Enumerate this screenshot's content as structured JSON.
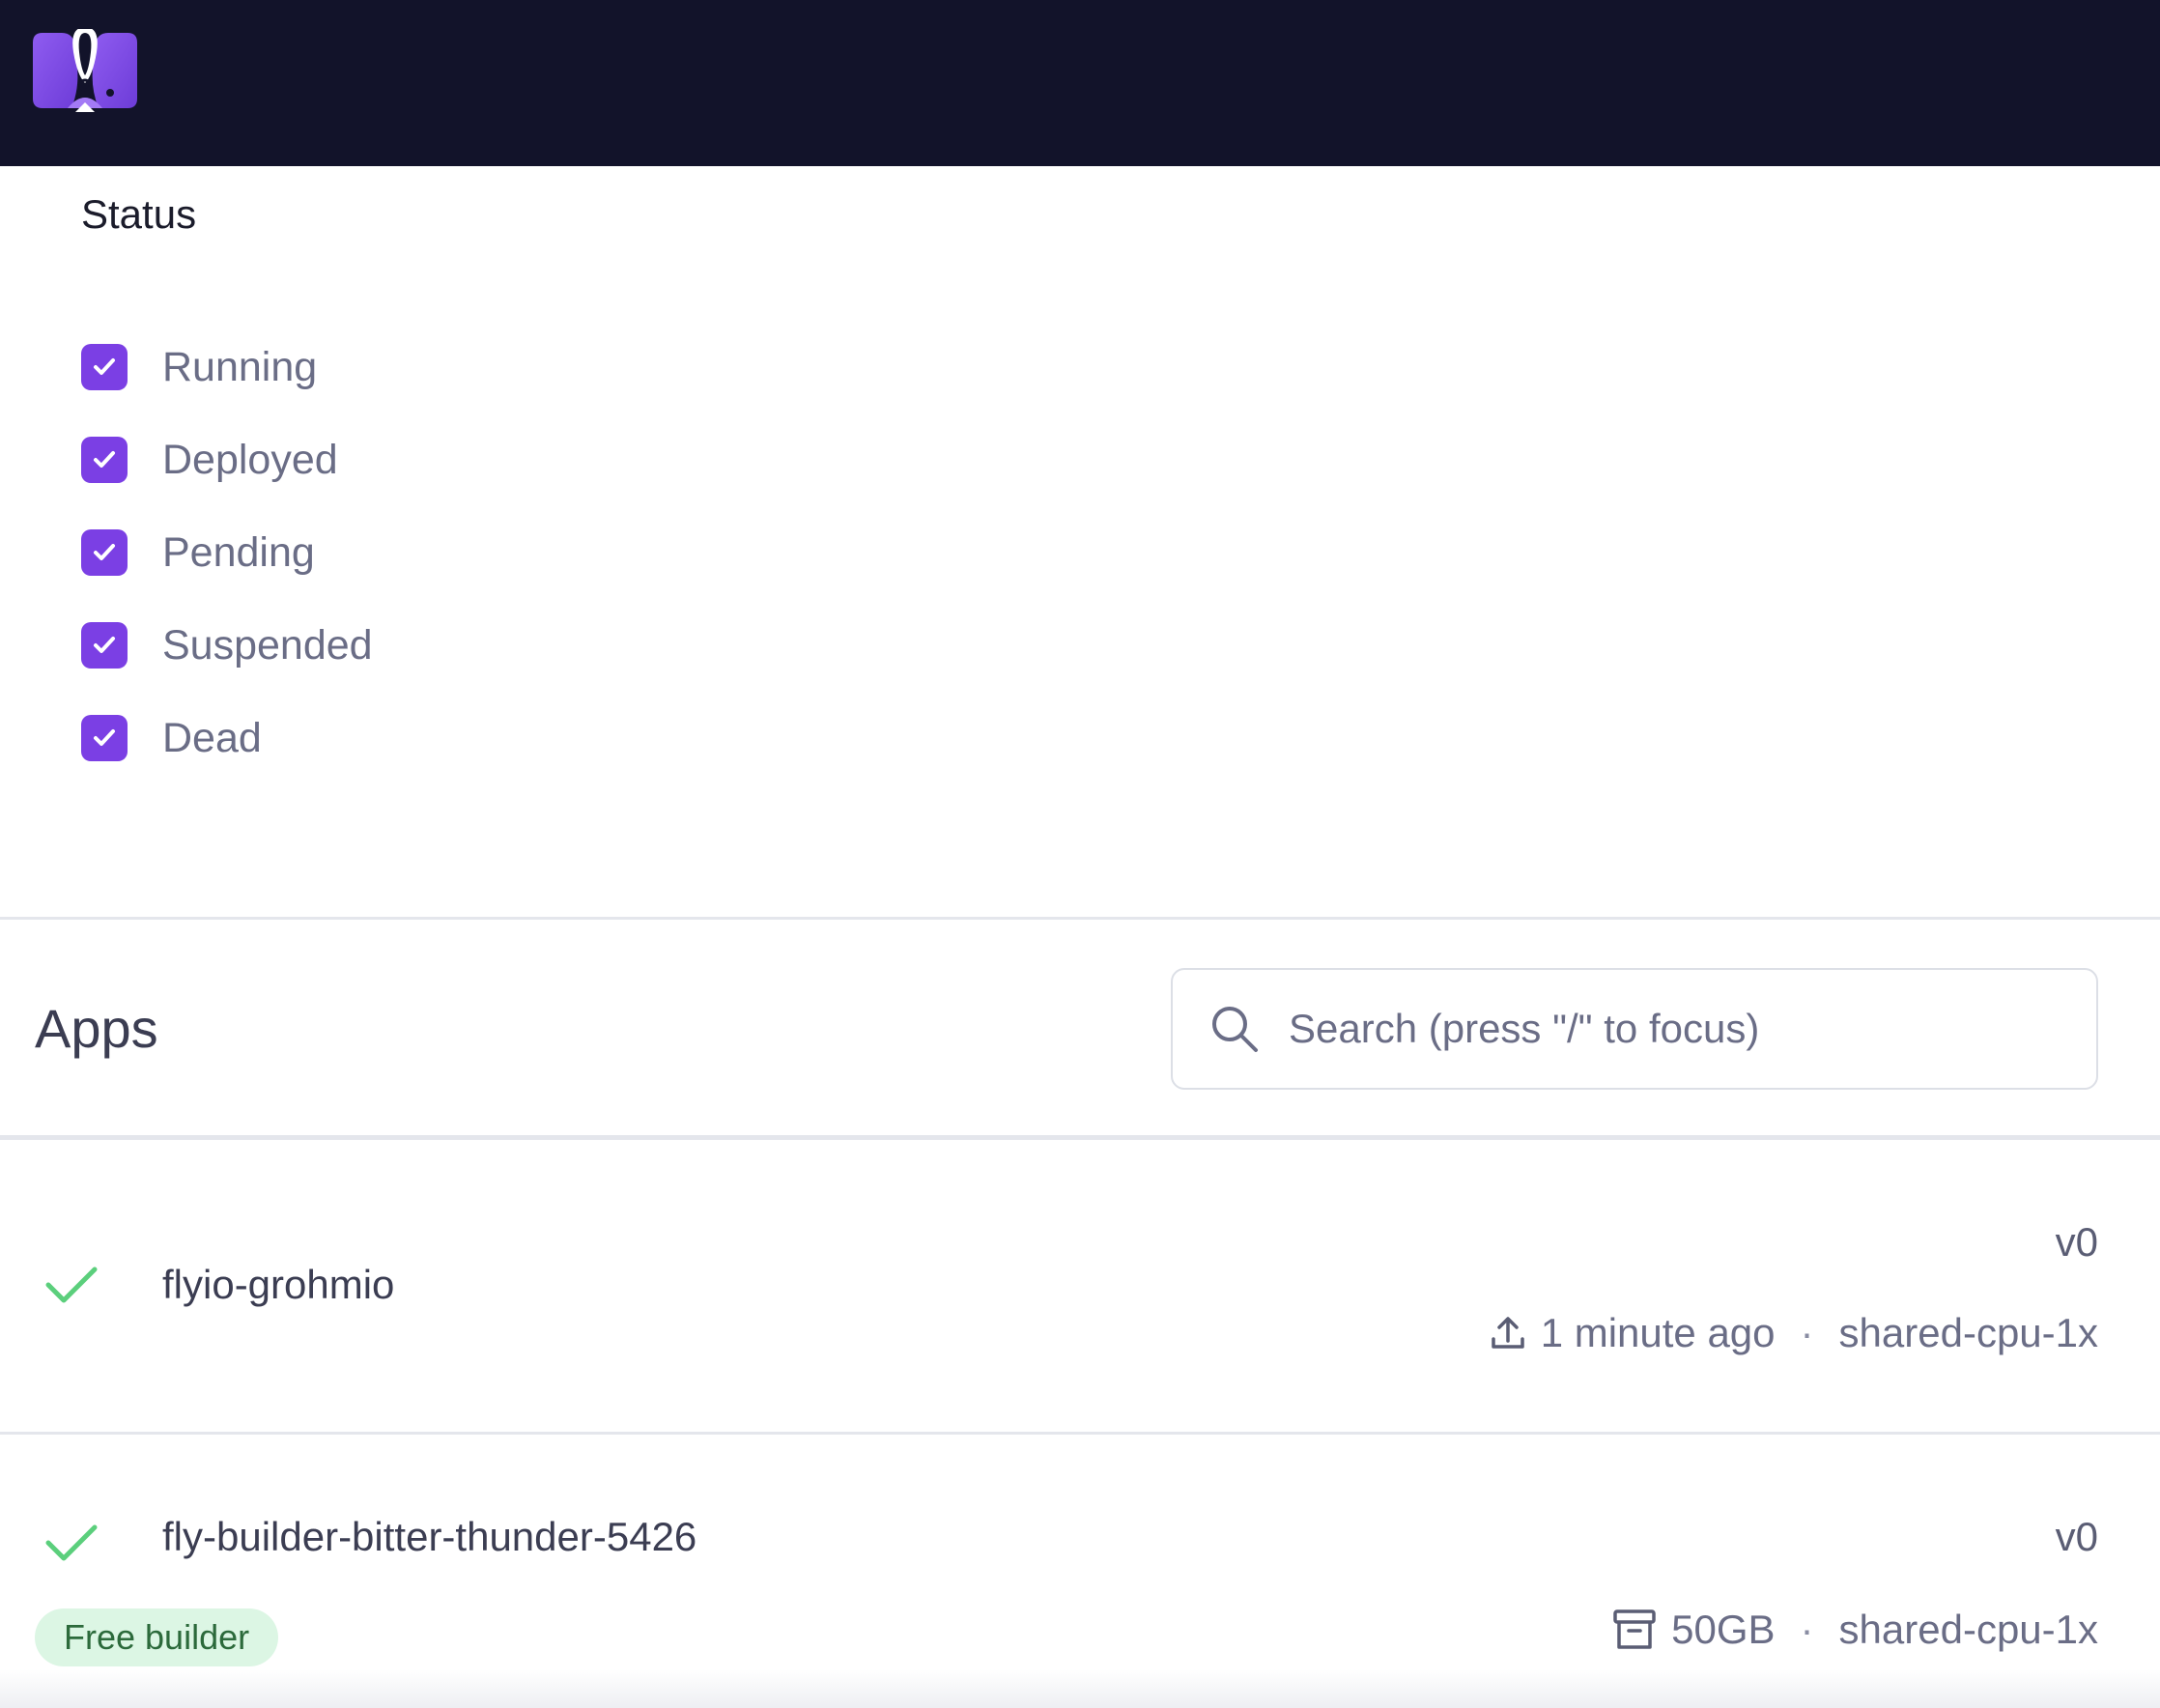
{
  "brand": {
    "logo_icon": "fly-balloon-logo-icon",
    "accent_color": "#7b3fe4",
    "header_color": "#12132a"
  },
  "status_filter": {
    "title": "Status",
    "options": [
      {
        "label": "Running",
        "checked": true
      },
      {
        "label": "Deployed",
        "checked": true
      },
      {
        "label": "Pending",
        "checked": true
      },
      {
        "label": "Suspended",
        "checked": true
      },
      {
        "label": "Dead",
        "checked": true
      }
    ]
  },
  "apps": {
    "title": "Apps",
    "search": {
      "placeholder": "Search (press \"/\" to focus)",
      "value": ""
    },
    "list": [
      {
        "name": "flyio-grohmio",
        "status_icon": "check-icon",
        "version": "v0",
        "meta_icon": "upload-icon",
        "meta_primary": "1 minute ago",
        "separator": "·",
        "machine": "shared-cpu-1x"
      },
      {
        "name": "fly-builder-bitter-thunder-5426",
        "status_icon": "check-icon",
        "version": "v0",
        "badge": "Free builder",
        "meta_icon": "archive-icon",
        "meta_primary": "50GB",
        "separator": "·",
        "machine": "shared-cpu-1x"
      }
    ]
  }
}
